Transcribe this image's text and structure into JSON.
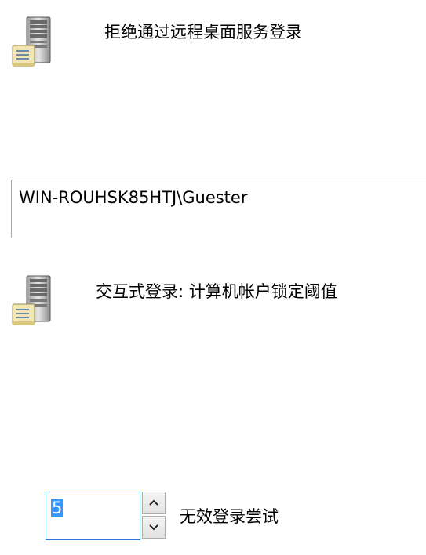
{
  "policies": [
    {
      "title": "拒绝通过远程桌面服务登录",
      "icon": "server-policy-icon"
    },
    {
      "title": "交互式登录: 计算机帐户锁定阈值",
      "icon": "server-policy-icon"
    }
  ],
  "user_list": {
    "entries": [
      "WIN-ROUHSK85HTJ\\Guester"
    ]
  },
  "lockout": {
    "value": "5",
    "label": "无效登录尝试"
  },
  "colors": {
    "selection": "#3399ff",
    "focus_border": "#2b79d6"
  }
}
